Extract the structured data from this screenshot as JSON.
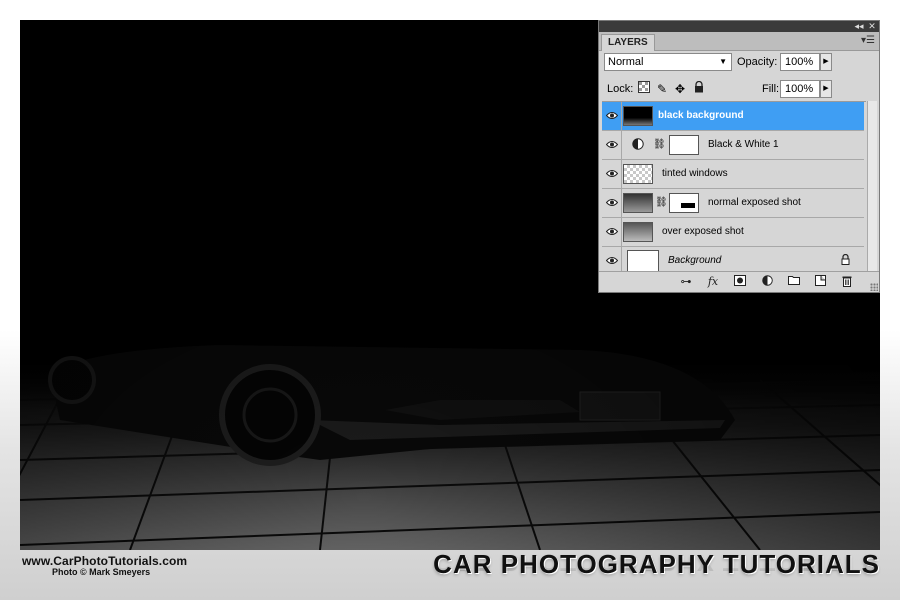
{
  "branding": {
    "site_url": "www.CarPhotoTutorials.com",
    "photo_credit": "Photo © Mark Smeyers",
    "title": "CAR PHOTOGRAPHY TUTORIALS"
  },
  "panel": {
    "tab_label": "LAYERS",
    "blend_mode": "Normal",
    "opacity_label": "Opacity:",
    "opacity_value": "100%",
    "lock_label": "Lock:",
    "fill_label": "Fill:",
    "fill_value": "100%",
    "selected_color": "#3f9ef3",
    "layers": [
      {
        "name": "black background",
        "selected": true
      },
      {
        "name": "Black & White 1",
        "selected": false
      },
      {
        "name": "tinted windows",
        "selected": false
      },
      {
        "name": "normal exposed shot",
        "selected": false
      },
      {
        "name": "over exposed shot",
        "selected": false
      },
      {
        "name": "Background",
        "selected": false
      }
    ],
    "footer_icons": [
      "link-icon",
      "fx-icon",
      "mask-icon",
      "adjustment-icon",
      "folder-icon",
      "new-layer-icon",
      "trash-icon"
    ]
  }
}
